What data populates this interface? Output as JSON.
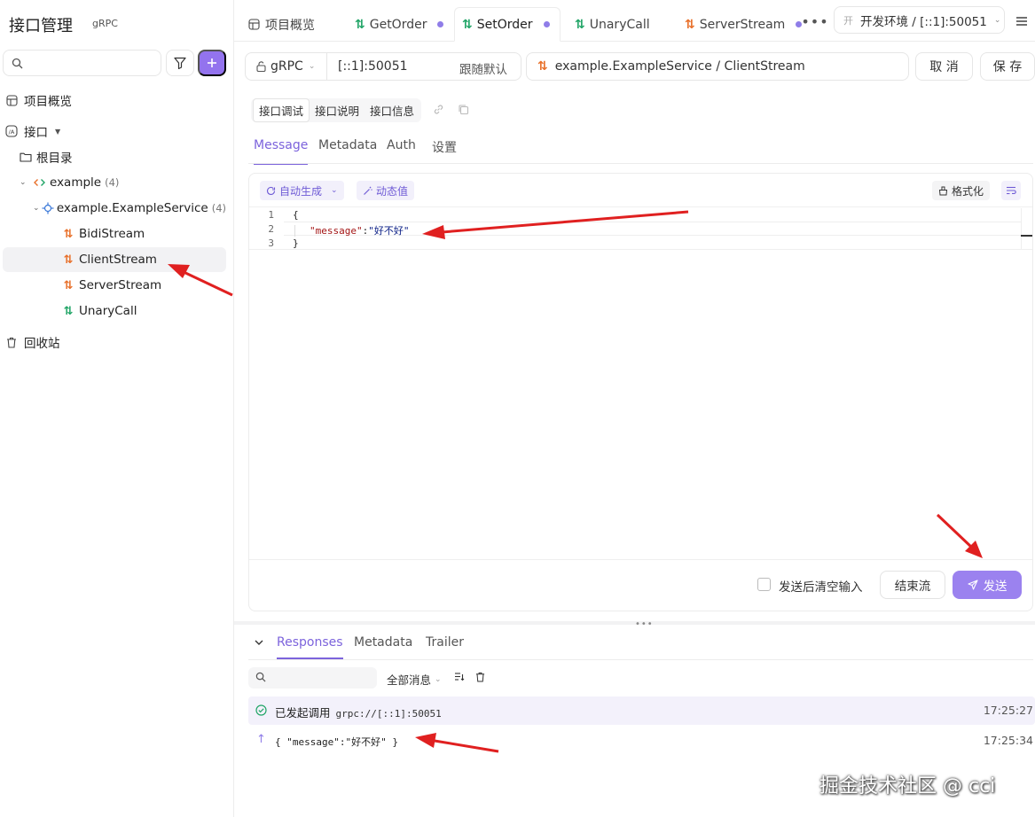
{
  "sidebar": {
    "title": "接口管理",
    "badge": "gRPC",
    "search": {
      "value": "",
      "placeholder": ""
    },
    "items": [
      {
        "label": "项目概览"
      },
      {
        "label": "接口"
      },
      {
        "label": "根目录"
      },
      {
        "label": "example",
        "count": "(4)"
      },
      {
        "label": "example.ExampleService",
        "count": "(4)"
      },
      {
        "label": "BidiStream",
        "method": "stream"
      },
      {
        "label": "ClientStream",
        "method": "stream"
      },
      {
        "label": "ServerStream",
        "method": "stream"
      },
      {
        "label": "UnaryCall",
        "method": "unary"
      },
      {
        "label": "回收站"
      }
    ]
  },
  "tabs": [
    {
      "label": "项目概览"
    },
    {
      "label": "GetOrder"
    },
    {
      "label": "SetOrder"
    },
    {
      "label": "UnaryCall"
    },
    {
      "label": "ServerStream"
    }
  ],
  "env": {
    "chip": "开",
    "label": "开发环境 / [::1]:50051"
  },
  "request": {
    "protocol": "gRPC",
    "url": "[::1]:50051",
    "url_follow": "跟随默认",
    "service": "example.ExampleService / ClientStream",
    "cancel": "取 消",
    "save": "保 存"
  },
  "subtabs": [
    "接口调试",
    "接口说明",
    "接口信息"
  ],
  "message_tabs": [
    "Message",
    "Metadata",
    "Auth",
    "设置"
  ],
  "editor": {
    "auto_generate": "自动生成",
    "dynamic_value": "动态值",
    "format": "格式化",
    "line_numbers": [
      "1",
      "2",
      "3"
    ],
    "line1": "{",
    "line2_key": "\"message\"",
    "line2_colon": ":",
    "line2_value": "\"好不好\"",
    "line3": "}",
    "clear_after_send": "发送后清空输入",
    "end_stream": "结束流",
    "send": "发送"
  },
  "response_tabs": [
    "Responses",
    "Metadata",
    "Trailer"
  ],
  "responses": {
    "search": {
      "value": "",
      "placeholder": ""
    },
    "filter": "全部消息",
    "rows": [
      {
        "text": "已发起调用",
        "url": "grpc://[::1]:50051",
        "time": "17:25:27"
      },
      {
        "text": "{ \"message\":\"好不好\" }",
        "time": "17:25:34"
      }
    ]
  },
  "watermark": "掘金技术社区 @ cci",
  "colors": {
    "accent": "#7c63dc",
    "button": "#9b82ef",
    "stream_method": "#e8702a",
    "unary_method": "#21a567",
    "annotation": "#e02020"
  }
}
